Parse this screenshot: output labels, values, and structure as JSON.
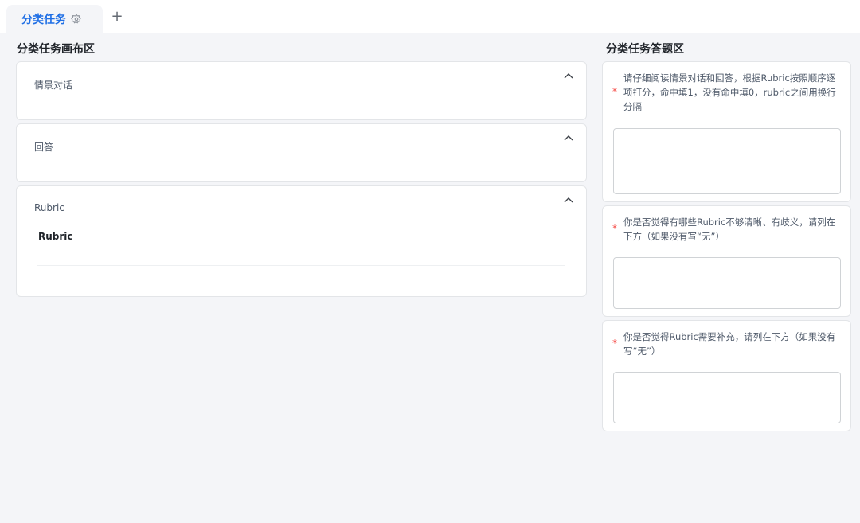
{
  "tabs": {
    "active_label": "分类任务",
    "add_label": "+"
  },
  "canvas": {
    "title": "分类任务画布区",
    "cards": [
      {
        "label": "情景对话"
      },
      {
        "label": "回答"
      },
      {
        "label": "Rubric",
        "sub_label": "Rubric"
      }
    ]
  },
  "answer": {
    "title": "分类任务答题区",
    "required_mark": "*",
    "questions": [
      {
        "text": "请仔细阅读情景对话和回答，根据Rubric按照顺序逐项打分，命中填1，没有命中填0，rubric之间用换行分隔",
        "value": ""
      },
      {
        "text": "你是否觉得有哪些Rubric不够清晰、有歧义，请列在下方（如果没有写“无”）",
        "value": ""
      },
      {
        "text": "你是否觉得Rubric需要补充，请列在下方（如果没有写“无”）",
        "value": ""
      }
    ]
  },
  "icons": {
    "tab_settings": "gear-icon",
    "collapse": "chevron-up-icon"
  },
  "colors": {
    "accent": "#1f6fe5",
    "required": "#f54a45"
  }
}
